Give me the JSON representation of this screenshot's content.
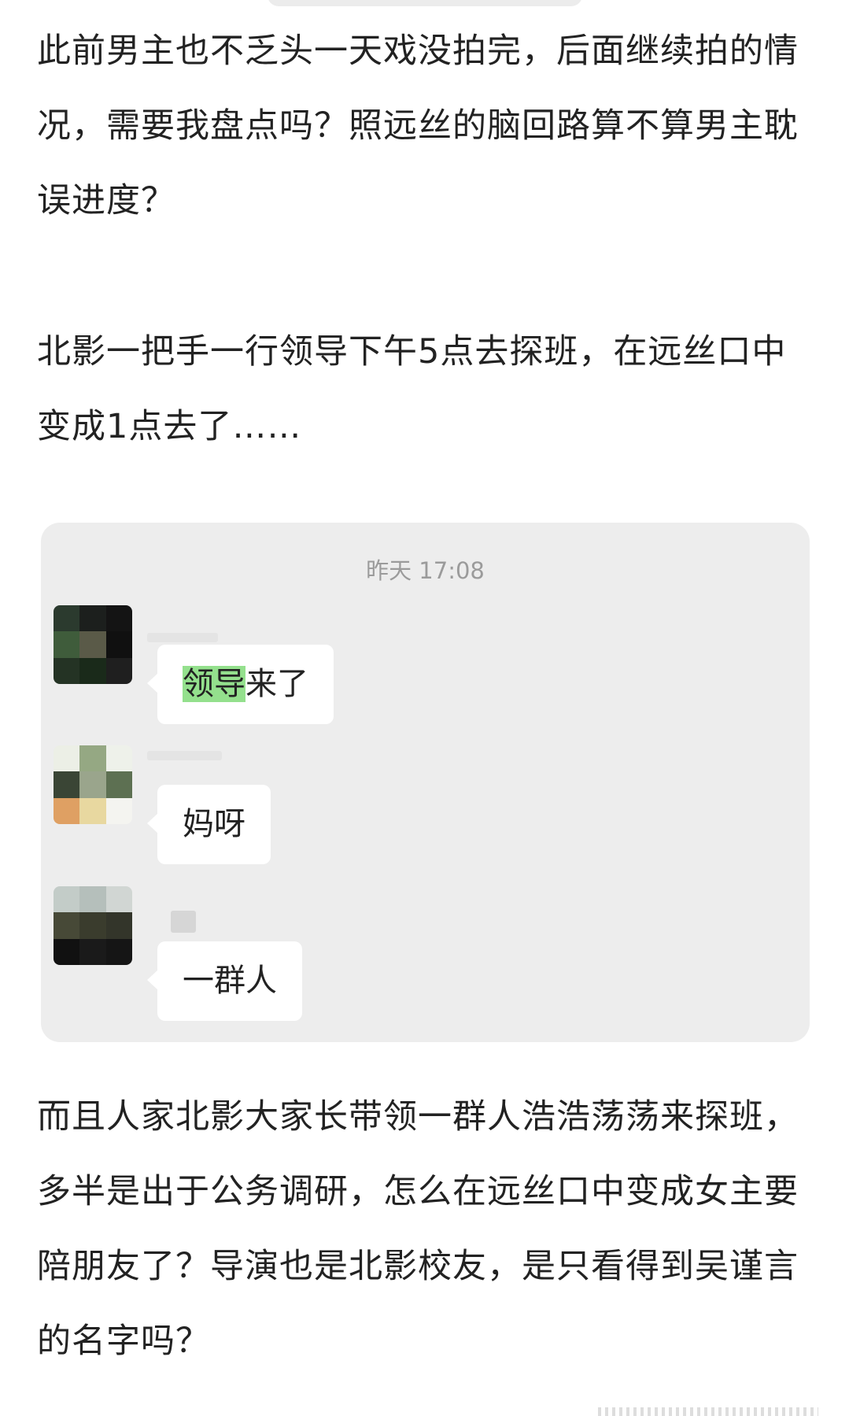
{
  "post": {
    "paragraph1": "此前男主也不乏头一天戏没拍完，后面继续拍的情况，需要我盘点吗？照远丝的脑回路算不算男主耽误进度？",
    "paragraph2": "北影一把手一行领导下午5点去探班，在远丝口中变成1点去了……",
    "paragraph3": "而且人家北影大家长带领一群人浩浩荡荡来探班，多半是出于公务调研，怎么在远丝口中变成女主要陪朋友了？导演也是北影校友，是只看得到吴谨言的名字吗？"
  },
  "chat": {
    "timestamp": "昨天 17:08",
    "messages": [
      {
        "highlight": "领导",
        "rest": "来了",
        "avatar_icon": "blurred-avatar"
      },
      {
        "text": "妈呀",
        "avatar_icon": "blurred-avatar"
      },
      {
        "text": "一群人",
        "avatar_icon": "blurred-avatar"
      }
    ],
    "highlight_color": "#94e08d",
    "card_color": "#ededed"
  }
}
